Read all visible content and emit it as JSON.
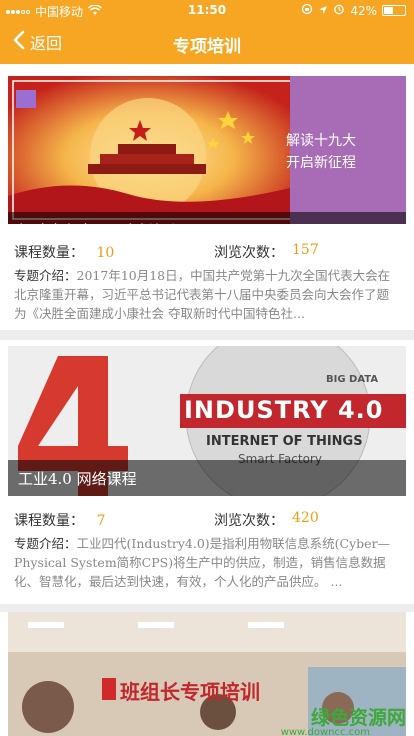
{
  "status_bar": {
    "carrier": "中国移动",
    "time": "11:50",
    "battery": "42%",
    "battery_level": 0.42
  },
  "nav": {
    "back_label": "返回",
    "title": "专项培训"
  },
  "courses": [
    {
      "banner_caption": "解读十九大，开启新征程",
      "side_text_1": "解读十九大",
      "side_text_2": "开启新征程",
      "count_label": "课程数量：",
      "count": "10",
      "views_label": "浏览次数：",
      "views": "157",
      "desc_label": "专题介绍：",
      "desc": "2017年10月18日，中国共产党第十九次全国代表大会在北京隆重开幕，习近平总书记代表第十八届中央委员会向大会作了题为《决胜全面建成小康社会 夺取新时代中国特色社..."
    },
    {
      "banner_caption": "工业4.0 网络课程",
      "art_number": "4.",
      "art_industry": "INDUSTRY 4.0",
      "art_iot": "INTERNET OF THINGS",
      "art_factory": "Smart Factory",
      "art_bigdata": "BIG DATA",
      "count_label": "课程数量：",
      "count": "7",
      "views_label": "浏览次数：",
      "views": "420",
      "desc_label": "专题介绍：",
      "desc": "工业四代(Industry4.0)是指利用物联信息系统(Cyber—Physical System简称CPS)将生产中的供应，制造，销售信息数据化、智慧化，最后达到快速，有效，个人化的产品供应。 ..."
    },
    {
      "banner_title": "班组长专项培训"
    }
  ],
  "watermark": {
    "main": "绿色资源网",
    "sub": "www.downcc.com"
  },
  "colors": {
    "accent": "#f6a623",
    "value": "#f39c12"
  }
}
